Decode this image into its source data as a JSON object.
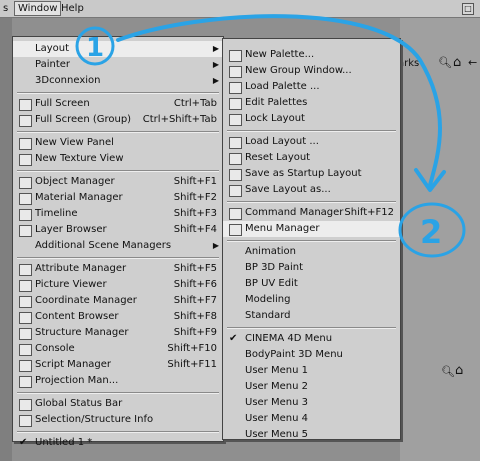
{
  "menubar": {
    "items": [
      {
        "label": "s"
      },
      {
        "label": "Window"
      },
      {
        "label": "Help"
      }
    ]
  },
  "background": {
    "marks_label": "arks"
  },
  "window_menu": {
    "items": [
      {
        "label": "Layout",
        "submenu": true,
        "icon": null
      },
      {
        "label": "Painter",
        "submenu": true,
        "icon": null
      },
      {
        "label": "3Dconnexion",
        "submenu": true,
        "icon": null
      },
      {
        "separator": true
      },
      {
        "label": "Full Screen",
        "shortcut": "Ctrl+Tab",
        "icon": "fullscreen-icon"
      },
      {
        "label": "Full Screen (Group)",
        "shortcut": "Ctrl+Shift+Tab",
        "icon": "fullscreen-group-icon"
      },
      {
        "separator": true
      },
      {
        "label": "New View Panel",
        "icon": "view-panel-icon"
      },
      {
        "label": "New Texture View",
        "icon": "texture-view-icon"
      },
      {
        "separator": true
      },
      {
        "label": "Object Manager",
        "shortcut": "Shift+F1",
        "icon": "object-manager-icon"
      },
      {
        "label": "Material Manager",
        "shortcut": "Shift+F2",
        "icon": "material-manager-icon"
      },
      {
        "label": "Timeline",
        "shortcut": "Shift+F3",
        "icon": "timeline-icon"
      },
      {
        "label": "Layer Browser",
        "shortcut": "Shift+F4",
        "icon": "layer-browser-icon"
      },
      {
        "label": "Additional Scene Managers",
        "submenu": true,
        "icon": null
      },
      {
        "separator": true
      },
      {
        "label": "Attribute Manager",
        "shortcut": "Shift+F5",
        "icon": "attribute-manager-icon"
      },
      {
        "label": "Picture Viewer",
        "shortcut": "Shift+F6",
        "icon": "picture-viewer-icon"
      },
      {
        "label": "Coordinate Manager",
        "shortcut": "Shift+F7",
        "icon": "coordinate-manager-icon"
      },
      {
        "label": "Content Browser",
        "shortcut": "Shift+F8",
        "icon": "content-browser-icon"
      },
      {
        "label": "Structure Manager",
        "shortcut": "Shift+F9",
        "icon": "structure-manager-icon"
      },
      {
        "label": "Console",
        "shortcut": "Shift+F10",
        "icon": "console-icon"
      },
      {
        "label": "Script Manager",
        "shortcut": "Shift+F11",
        "icon": "script-manager-icon"
      },
      {
        "label": "Projection Man...",
        "icon": "projection-manager-icon"
      },
      {
        "separator": true
      },
      {
        "label": "Global Status Bar",
        "icon": "status-bar-icon"
      },
      {
        "label": "Selection/Structure Info",
        "icon": "selection-info-icon"
      },
      {
        "separator": true
      },
      {
        "label": "Untitled 1 *",
        "checked": true,
        "icon": null
      }
    ]
  },
  "layout_submenu": {
    "items": [
      {
        "label": "New Palette...",
        "icon": "new-palette-icon"
      },
      {
        "label": "New Group Window...",
        "icon": "new-group-window-icon"
      },
      {
        "label": "Load Palette ...",
        "icon": "load-palette-icon"
      },
      {
        "label": "Edit Palettes",
        "icon": "edit-palettes-icon"
      },
      {
        "label": "Lock Layout",
        "icon": "lock-layout-icon"
      },
      {
        "separator": true
      },
      {
        "label": "Load Layout ...",
        "icon": "load-layout-icon"
      },
      {
        "label": "Reset Layout",
        "icon": "reset-layout-icon"
      },
      {
        "label": "Save as Startup Layout",
        "icon": "save-startup-layout-icon"
      },
      {
        "label": "Save Layout as...",
        "icon": "save-layout-icon"
      },
      {
        "separator": true
      },
      {
        "label": "Command Manager",
        "shortcut": "Shift+F12",
        "icon": "command-manager-icon"
      },
      {
        "label": "Menu Manager",
        "icon": "menu-manager-icon",
        "highlighted": true
      },
      {
        "separator": true
      },
      {
        "label": "Animation"
      },
      {
        "label": "BP 3D Paint"
      },
      {
        "label": "BP UV Edit"
      },
      {
        "label": "Modeling"
      },
      {
        "label": "Standard"
      },
      {
        "separator": true
      },
      {
        "label": "CINEMA 4D Menu",
        "checked": true
      },
      {
        "label": "BodyPaint 3D Menu"
      },
      {
        "label": "User Menu 1"
      },
      {
        "label": "User Menu 2"
      },
      {
        "label": "User Menu 3"
      },
      {
        "label": "User Menu 4"
      },
      {
        "label": "User Menu 5"
      }
    ]
  },
  "annotations": {
    "one": "1",
    "two": "2",
    "color": "#2aa3e6"
  }
}
